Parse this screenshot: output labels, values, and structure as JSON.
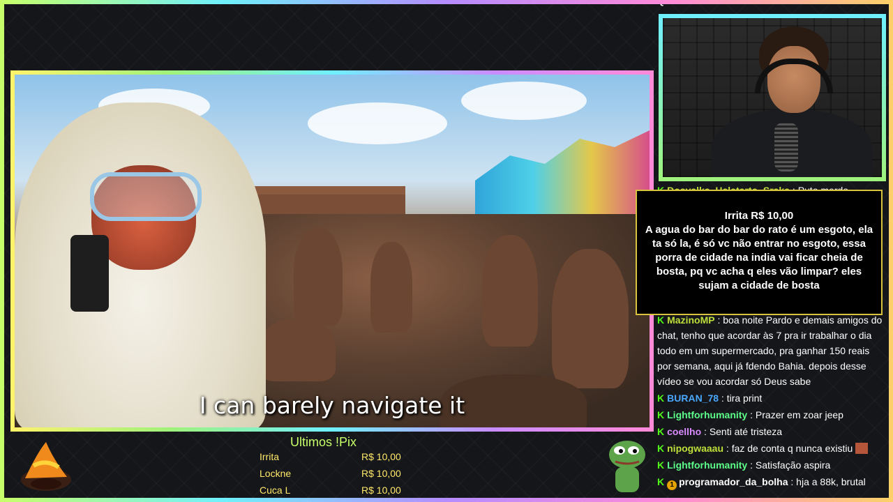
{
  "header": {
    "cut_text": "QUE DESCRIPELLAR!!!!!!"
  },
  "video": {
    "subtitle": "I can barely navigate it"
  },
  "alert": {
    "title": "Irrita R$ 10,00",
    "message": "A agua do bar do bar do rato é um esgoto, ela ta só la, é só vc não entrar no esgoto, essa porra de cidade na india vai ficar cheia de bosta, pq vc acha q eles vão limpar? eles sujam a cidade de bosta"
  },
  "chat": {
    "messages": [
      {
        "user": "Dosvalka_Hslstarto_Sraka",
        "color": "#bfe03a",
        "text": "Puto merdo",
        "badge": ""
      },
      {
        "user": "MazinoMP",
        "color": "#bfe03a",
        "text": "boa noite Pardo e demais amigos do chat, tenho que acordar às 7 pra ir trabalhar o dia todo em um supermercado, pra ganhar 150 reais por semana, aqui já fdendo Bahia. depois desse vídeo se vou acordar só Deus sabe",
        "badge": ""
      },
      {
        "user": "BURAN_78",
        "color": "#4aa8ff",
        "text": "tira print",
        "badge": ""
      },
      {
        "user": "Lightforhumanity",
        "color": "#5dff8a",
        "text": "Prazer em zoar jeep",
        "badge": ""
      },
      {
        "user": "coellho",
        "color": "#d98cff",
        "text": "Senti até tristeza",
        "badge": ""
      },
      {
        "user": "nipogwaaau",
        "color": "#bfe03a",
        "text": "faz de conta q nunca existiu",
        "badge": ""
      },
      {
        "user": "Lightforhumanity",
        "color": "#5dff8a",
        "text": "Satisfação aspira",
        "badge": ""
      },
      {
        "user": "programador_da_bolha",
        "color": "#ffffff",
        "text": "hja a 88k, brutal",
        "badge": "1"
      }
    ],
    "k_icon": "K"
  },
  "pix": {
    "title": "Ultimos !Pix",
    "entries": [
      {
        "name": "Irrita",
        "value": "R$ 10,00"
      },
      {
        "name": "Lockne",
        "value": "R$ 10,00"
      },
      {
        "name": "Cuca L",
        "value": "R$ 10,00"
      }
    ]
  },
  "icons": {
    "kick_badge": "kick-k-icon",
    "mascot_left": "wizard-hat-mascot-icon",
    "mascot_right": "pepe-frog-icon"
  }
}
